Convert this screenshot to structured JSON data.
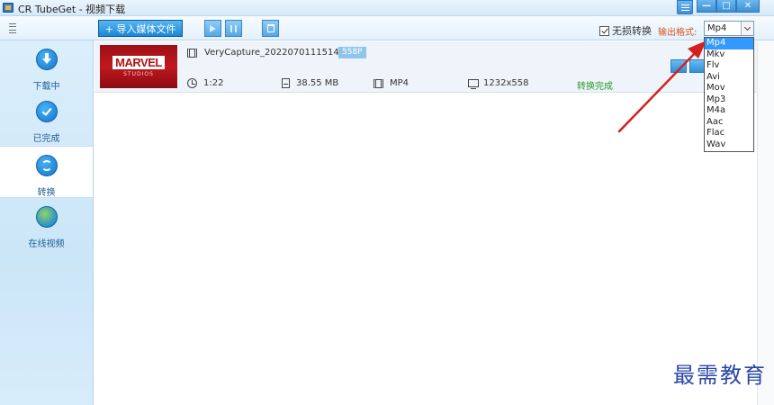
{
  "window": {
    "title": "CR TubeGet - 视频下载",
    "min_label": "—",
    "max_label": "□",
    "close_label": "✕"
  },
  "toolbar": {
    "import_label": "+ 导入媒体文件",
    "lossless_label": "无损转换",
    "lossless_checked": true,
    "output_format_label": "输出格式:",
    "output_format_value": "Mp4"
  },
  "format_options": [
    "Mp4",
    "Mkv",
    "Flv",
    "Avi",
    "Mov",
    "Mp3",
    "M4a",
    "Aac",
    "Flac",
    "Wav"
  ],
  "sidebar": {
    "items": [
      {
        "label": "下载中",
        "icon": "download-icon"
      },
      {
        "label": "已完成",
        "icon": "check-icon"
      },
      {
        "label": "转换",
        "icon": "convert-icon",
        "active": true
      },
      {
        "label": "在线视频",
        "icon": "globe-icon"
      }
    ]
  },
  "files": [
    {
      "thumb_title": "MARVEL",
      "thumb_subtitle": "STUDIOS",
      "filename": "VeryCapture_20220701115140",
      "quality": "558P",
      "duration": "1:22",
      "size": "38.55 MB",
      "format": "MP4",
      "resolution": "1232x558",
      "status": "转换完成"
    }
  ],
  "watermark": "最需教育",
  "colors": {
    "accent": "#1c86d6",
    "status_done": "#2a9c2a",
    "output_label": "#d9541e",
    "arrow": "#d42020"
  }
}
